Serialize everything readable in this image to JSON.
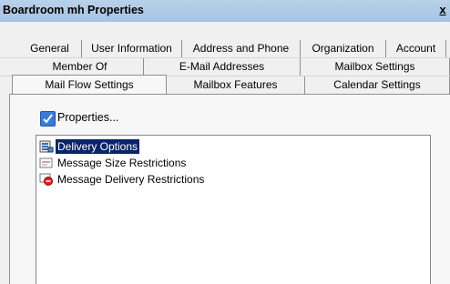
{
  "window": {
    "title": "Boardroom mh Properties",
    "close_label": "x"
  },
  "tabs": {
    "row1": [
      "General",
      "User Information",
      "Address and Phone",
      "Organization",
      "Account"
    ],
    "row2": [
      "Member Of",
      "E-Mail Addresses",
      "Mailbox Settings"
    ],
    "row3": [
      "Mail Flow Settings",
      "Mailbox Features",
      "Calendar Settings"
    ],
    "active": "Mail Flow Settings"
  },
  "properties_button": {
    "label": "Properties...",
    "checked": true
  },
  "list": {
    "items": [
      {
        "label": "Delivery Options",
        "icon": "delivery-options-icon",
        "selected": true
      },
      {
        "label": "Message Size Restrictions",
        "icon": "message-size-icon",
        "selected": false
      },
      {
        "label": "Message Delivery Restrictions",
        "icon": "message-delivery-restrictions-icon",
        "selected": false
      }
    ]
  },
  "colors": {
    "selection": "#0a246a",
    "titlebar": "#b9d1ea",
    "checkbox": "#3a7bd5"
  }
}
